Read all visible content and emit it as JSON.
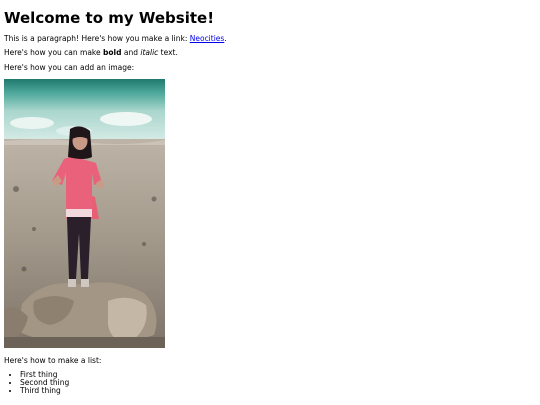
{
  "heading": "Welcome to my Website!",
  "paragraph1": {
    "text": "This is a paragraph! Here's how you make a link: ",
    "link": "Neocities",
    "end": "."
  },
  "paragraph2": {
    "before": "Here's how you can make ",
    "bold": "bold",
    "middle": " and ",
    "italic": "italic",
    "after": " text."
  },
  "paragraph3": "Here's how you can add an image:",
  "image": {
    "subject": "photo of a woman in a pink sweater standing on rocks in a desert landscape"
  },
  "list_intro": "Here's how to make a list:",
  "list_items": [
    "First thing",
    "Second thing",
    "Third thing"
  ],
  "link_color": "#0000ee"
}
